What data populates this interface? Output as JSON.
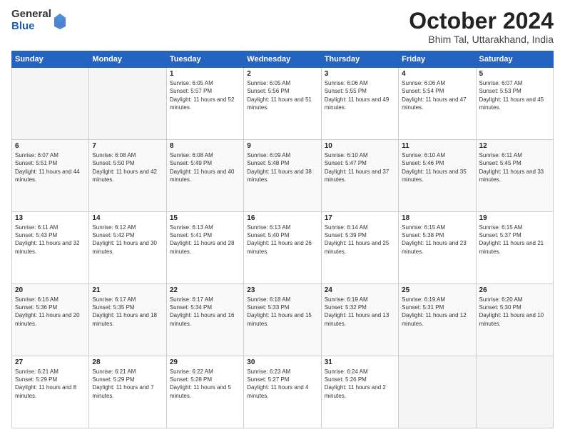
{
  "logo": {
    "general": "General",
    "blue": "Blue"
  },
  "header": {
    "month": "October 2024",
    "location": "Bhim Tal, Uttarakhand, India"
  },
  "days_of_week": [
    "Sunday",
    "Monday",
    "Tuesday",
    "Wednesday",
    "Thursday",
    "Friday",
    "Saturday"
  ],
  "weeks": [
    [
      {
        "day": "",
        "empty": true
      },
      {
        "day": "",
        "empty": true
      },
      {
        "day": "1",
        "sunrise": "6:05 AM",
        "sunset": "5:57 PM",
        "daylight": "11 hours and 52 minutes."
      },
      {
        "day": "2",
        "sunrise": "6:05 AM",
        "sunset": "5:56 PM",
        "daylight": "11 hours and 51 minutes."
      },
      {
        "day": "3",
        "sunrise": "6:06 AM",
        "sunset": "5:55 PM",
        "daylight": "11 hours and 49 minutes."
      },
      {
        "day": "4",
        "sunrise": "6:06 AM",
        "sunset": "5:54 PM",
        "daylight": "11 hours and 47 minutes."
      },
      {
        "day": "5",
        "sunrise": "6:07 AM",
        "sunset": "5:53 PM",
        "daylight": "11 hours and 45 minutes."
      }
    ],
    [
      {
        "day": "6",
        "sunrise": "6:07 AM",
        "sunset": "5:51 PM",
        "daylight": "11 hours and 44 minutes."
      },
      {
        "day": "7",
        "sunrise": "6:08 AM",
        "sunset": "5:50 PM",
        "daylight": "11 hours and 42 minutes."
      },
      {
        "day": "8",
        "sunrise": "6:08 AM",
        "sunset": "5:49 PM",
        "daylight": "11 hours and 40 minutes."
      },
      {
        "day": "9",
        "sunrise": "6:09 AM",
        "sunset": "5:48 PM",
        "daylight": "11 hours and 38 minutes."
      },
      {
        "day": "10",
        "sunrise": "6:10 AM",
        "sunset": "5:47 PM",
        "daylight": "11 hours and 37 minutes."
      },
      {
        "day": "11",
        "sunrise": "6:10 AM",
        "sunset": "5:46 PM",
        "daylight": "11 hours and 35 minutes."
      },
      {
        "day": "12",
        "sunrise": "6:11 AM",
        "sunset": "5:45 PM",
        "daylight": "11 hours and 33 minutes."
      }
    ],
    [
      {
        "day": "13",
        "sunrise": "6:11 AM",
        "sunset": "5:43 PM",
        "daylight": "11 hours and 32 minutes."
      },
      {
        "day": "14",
        "sunrise": "6:12 AM",
        "sunset": "5:42 PM",
        "daylight": "11 hours and 30 minutes."
      },
      {
        "day": "15",
        "sunrise": "6:13 AM",
        "sunset": "5:41 PM",
        "daylight": "11 hours and 28 minutes."
      },
      {
        "day": "16",
        "sunrise": "6:13 AM",
        "sunset": "5:40 PM",
        "daylight": "11 hours and 26 minutes."
      },
      {
        "day": "17",
        "sunrise": "6:14 AM",
        "sunset": "5:39 PM",
        "daylight": "11 hours and 25 minutes."
      },
      {
        "day": "18",
        "sunrise": "6:15 AM",
        "sunset": "5:38 PM",
        "daylight": "11 hours and 23 minutes."
      },
      {
        "day": "19",
        "sunrise": "6:15 AM",
        "sunset": "5:37 PM",
        "daylight": "11 hours and 21 minutes."
      }
    ],
    [
      {
        "day": "20",
        "sunrise": "6:16 AM",
        "sunset": "5:36 PM",
        "daylight": "11 hours and 20 minutes."
      },
      {
        "day": "21",
        "sunrise": "6:17 AM",
        "sunset": "5:35 PM",
        "daylight": "11 hours and 18 minutes."
      },
      {
        "day": "22",
        "sunrise": "6:17 AM",
        "sunset": "5:34 PM",
        "daylight": "11 hours and 16 minutes."
      },
      {
        "day": "23",
        "sunrise": "6:18 AM",
        "sunset": "5:33 PM",
        "daylight": "11 hours and 15 minutes."
      },
      {
        "day": "24",
        "sunrise": "6:19 AM",
        "sunset": "5:32 PM",
        "daylight": "11 hours and 13 minutes."
      },
      {
        "day": "25",
        "sunrise": "6:19 AM",
        "sunset": "5:31 PM",
        "daylight": "11 hours and 12 minutes."
      },
      {
        "day": "26",
        "sunrise": "6:20 AM",
        "sunset": "5:30 PM",
        "daylight": "11 hours and 10 minutes."
      }
    ],
    [
      {
        "day": "27",
        "sunrise": "6:21 AM",
        "sunset": "5:29 PM",
        "daylight": "11 hours and 8 minutes."
      },
      {
        "day": "28",
        "sunrise": "6:21 AM",
        "sunset": "5:29 PM",
        "daylight": "11 hours and 7 minutes."
      },
      {
        "day": "29",
        "sunrise": "6:22 AM",
        "sunset": "5:28 PM",
        "daylight": "11 hours and 5 minutes."
      },
      {
        "day": "30",
        "sunrise": "6:23 AM",
        "sunset": "5:27 PM",
        "daylight": "11 hours and 4 minutes."
      },
      {
        "day": "31",
        "sunrise": "6:24 AM",
        "sunset": "5:26 PM",
        "daylight": "11 hours and 2 minutes."
      },
      {
        "day": "",
        "empty": true
      },
      {
        "day": "",
        "empty": true
      }
    ]
  ]
}
